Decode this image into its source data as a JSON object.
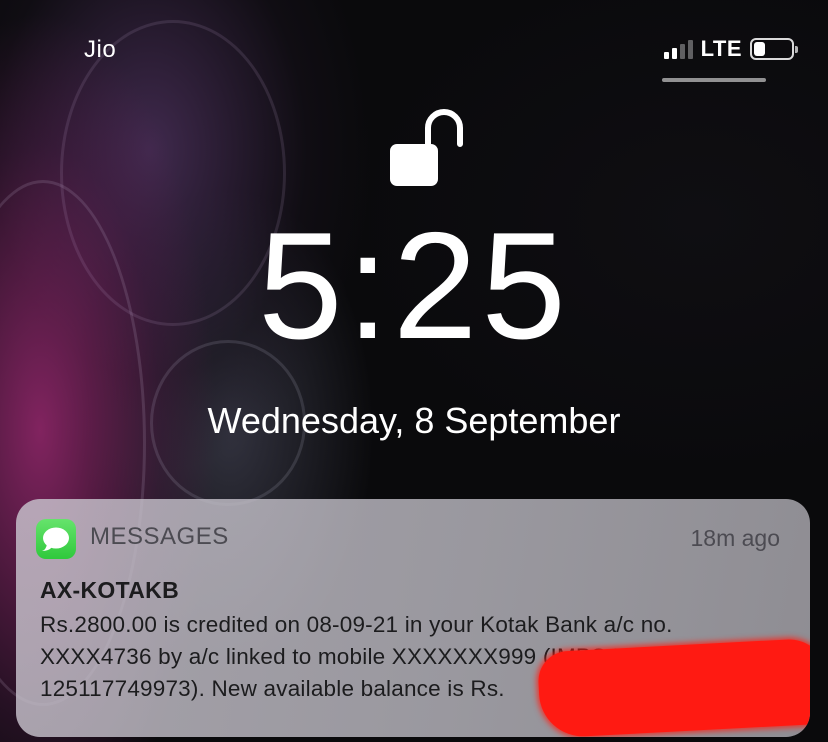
{
  "status_bar": {
    "carrier": "Jio",
    "network": "LTE",
    "signal_bars": 4,
    "signal_bars_active": 2,
    "battery_level": 0.3
  },
  "lock_screen": {
    "time": "5:25",
    "date": "Wednesday, 8 September",
    "lock_state_icon": "unlocked-padlock-icon"
  },
  "notification": {
    "app_name": "MESSAGES",
    "time_ago": "18m ago",
    "sender": "AX-KOTAKB",
    "lines": [
      "Rs.2800.00 is credited on 08-09-21 in your Kotak Bank a/c no.",
      "XXXX4736 by a/c linked to mobile XXXXXXX999 (IMPS Ref no",
      "125117749973). New available balance is Rs."
    ],
    "app_icon": "messages-bubble-icon",
    "app_icon_color": "#34c759",
    "redaction_color": "#ff1a12"
  }
}
